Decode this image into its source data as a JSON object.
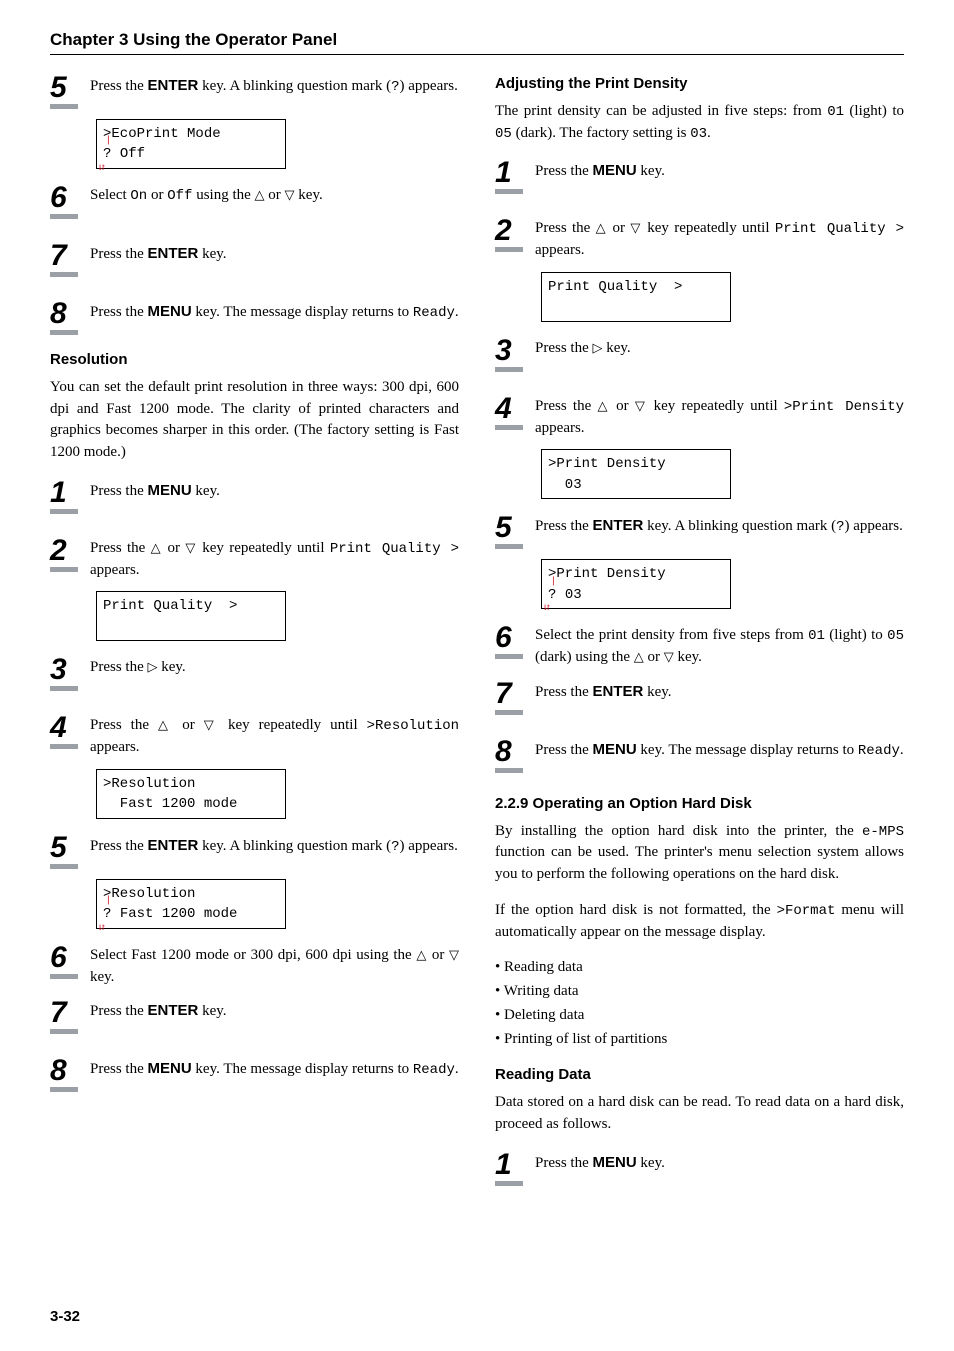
{
  "chapter": "Chapter 3  Using the Operator Panel",
  "footer": "3-32",
  "keys": {
    "enter": "ENTER",
    "menu": "MENU"
  },
  "code": {
    "on": "On",
    "off": "Off",
    "ready": "Ready",
    "printQuality": "Print Quality",
    "resolution": ">Resolution",
    "printDensity": ">Print Density",
    "ecoPrint": ">EcoPrint Mode",
    "qmark": "?",
    "fast1200": "Fast 1200 mode",
    "gt": ">",
    "emps": "e-MPS",
    "formatMenu": ">Format",
    "printQualityGt": "Print Quality  >",
    "num01": "01",
    "num03": "03",
    "num05": "05"
  },
  "left": {
    "s5": "Press the {ENTER} key. A blinking question mark ({?}) appears.",
    "lcd5_l1": ">EcoPrint Mode",
    "lcd5_l2": "Off",
    "s6": "Select {On} or {Off} using the △ or ▽ key.",
    "s7": "Press the {ENTER} key.",
    "s8": "Press the {MENU} key. The message display returns to {Ready}.",
    "resolution_h": "Resolution",
    "resolution_p": "You can set the default print resolution in three ways: 300 dpi, 600 dpi and Fast 1200 mode. The clarity of printed characters and graphics becomes sharper in this order. (The factory setting is Fast 1200 mode.)",
    "r1": "Press the {MENU} key.",
    "r2": "Press the △ or ▽ key repeatedly until {PrintQualityGt} appears.",
    "lcd_r2": "Print Quality  >",
    "r3": "Press the ▷ key.",
    "r4": "Press the △ or ▽ key repeatedly until {>Resolution} appears.",
    "lcd_r4_l1": ">Resolution",
    "lcd_r4_l2": "  Fast 1200 mode",
    "r5": "Press the {ENTER} key. A blinking question mark ({?}) appears.",
    "lcd_r5_l1": ">Resolution",
    "lcd_r5_l2": "Fast 1200 mode",
    "r6": "Select Fast 1200 mode or 300 dpi, 600 dpi using the △ or ▽ key.",
    "r7": "Press the {ENTER} key.",
    "r8": "Press the {MENU} key. The message display returns to {Ready}."
  },
  "right": {
    "adj_h": "Adjusting the Print Density",
    "adj_p": "The print density can be adjusted in five steps: from {01} (light) to {05} (dark). The factory setting is {03}.",
    "d1": "Press the {MENU} key.",
    "d2": "Press the △ or ▽ key repeatedly until {PrintQualityGt} appears.",
    "lcd_d2": "Print Quality  >",
    "d3": "Press the ▷ key.",
    "d4": "Press the △ or ▽ key repeatedly until {>PrintDensity} appears.",
    "lcd_d4_l1": ">Print Density",
    "lcd_d4_l2": "  03",
    "d5": "Press the {ENTER} key. A blinking question mark ({?}) appears.",
    "lcd_d5_l1": ">Print Density",
    "lcd_d5_l2": "03",
    "d6": "Select the print density from five steps from {01} (light) to {05} (dark) using the △ or ▽ key.",
    "d7": "Press the {ENTER} key.",
    "d8": "Press the {MENU} key. The message display returns to {Ready}.",
    "opt_h": "2.2.9 Operating an Option Hard Disk",
    "opt_p1": "By installing the option hard disk into the printer, the {e-MPS} function can be used. The printer's menu selection system allows you to perform the following operations on the hard disk.",
    "opt_p2": "If the option hard disk is not formatted, the {>Format} menu will automatically appear on the message display.",
    "bullets": [
      "Reading data",
      "Writing data",
      "Deleting data",
      "Printing of list of partitions"
    ],
    "read_h": "Reading Data",
    "read_p": "Data stored on a hard disk can be read. To read data on a hard disk, proceed as follows.",
    "read_1": "Press the {MENU} key."
  }
}
